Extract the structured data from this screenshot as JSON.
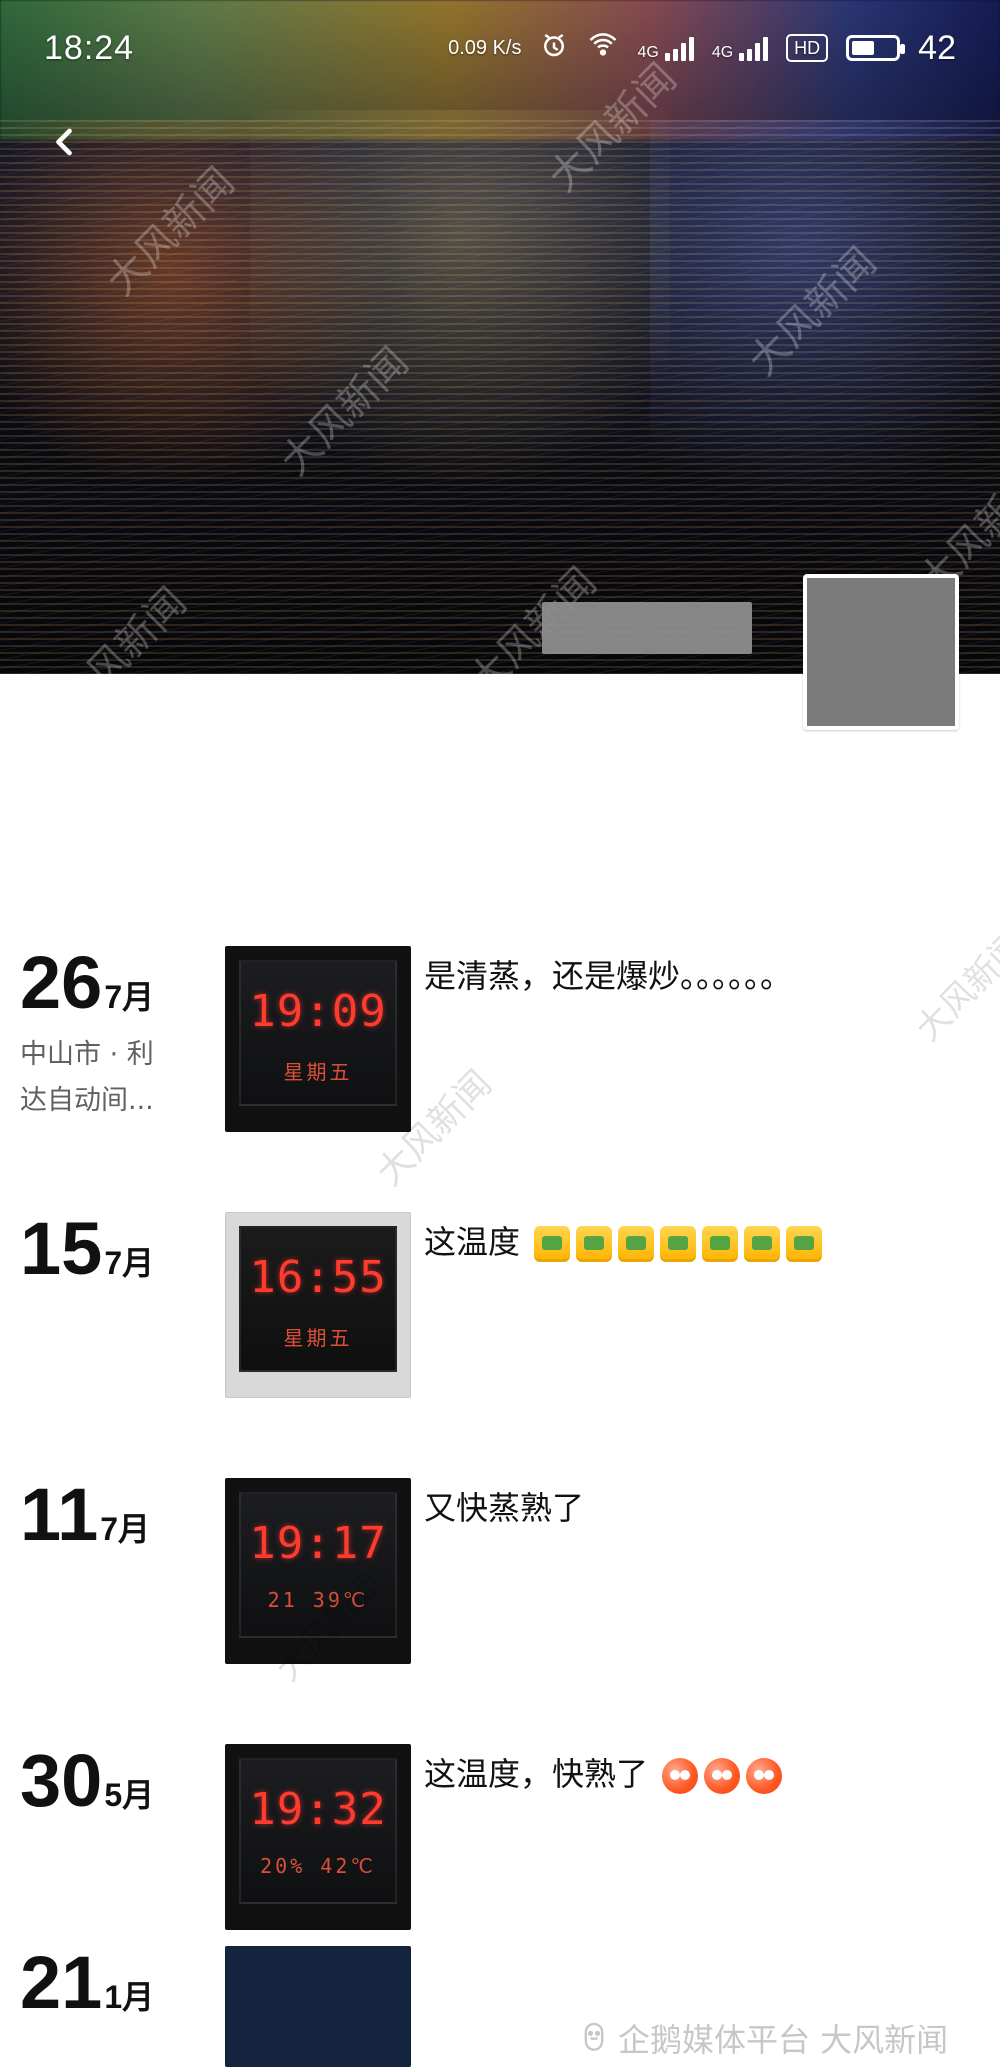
{
  "status_bar": {
    "time": "18:24",
    "network_speed": "0.09 K/s",
    "signal_1": "4G",
    "signal_2": "4G",
    "hd": "HD",
    "battery_level": "42"
  },
  "header": {
    "back_icon": "chevron-left-icon",
    "cover_desc": "night river cover photo"
  },
  "watermark_text": "大风新闻",
  "feed": {
    "posts": [
      {
        "day": "26",
        "month": "7月",
        "location": "中山市 · 利达自动间...",
        "text": "是清蒸，还是爆炒。。。。。。",
        "thumb_clock": "19:09",
        "thumb_row": "星期五"
      },
      {
        "day": "15",
        "month": "7月",
        "location": "",
        "text": "这温度",
        "emoji": [
          "thumb-up-icon",
          "thumb-up-icon",
          "thumb-up-icon",
          "thumb-up-icon",
          "thumb-up-icon",
          "thumb-up-icon",
          "thumb-up-icon"
        ],
        "thumb_clock": "16:55",
        "thumb_row": "星期五"
      },
      {
        "day": "11",
        "month": "7月",
        "location": "",
        "text": "又快蒸熟了",
        "thumb_clock": "19:17",
        "thumb_row": "21 39℃"
      },
      {
        "day": "30",
        "month": "5月",
        "location": "",
        "text": "这温度，快熟了",
        "emoji": [
          "hot-face-icon",
          "hot-face-icon",
          "hot-face-icon"
        ],
        "thumb_clock": "19:32",
        "thumb_row": "20% 42℃"
      }
    ],
    "partial": {
      "day": "21",
      "month": "1月"
    }
  },
  "bottom_watermark": {
    "text": "企鹅媒体平台 大风新闻",
    "icon": "penguin-icon"
  }
}
